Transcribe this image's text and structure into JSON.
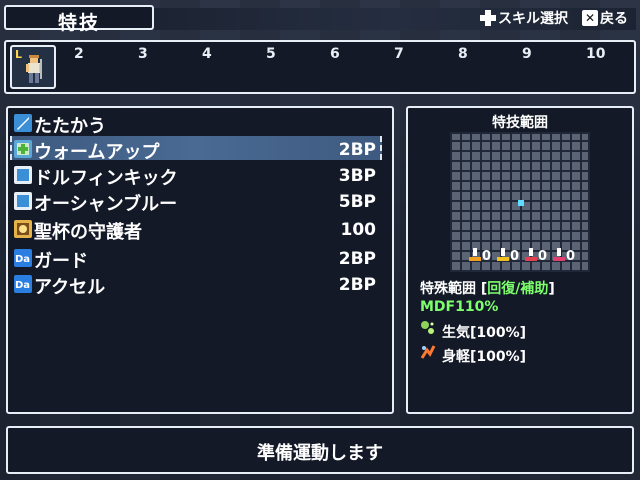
{
  "title": "特技",
  "hints": {
    "skill_select": "スキル選択",
    "back": "戻る",
    "back_key": "✕"
  },
  "party": {
    "leader_level_mark": "L",
    "slots": [
      "2",
      "3",
      "4",
      "5",
      "6",
      "7",
      "8",
      "9",
      "10"
    ]
  },
  "skills": [
    {
      "name": "たたかう",
      "cost": "",
      "icon": "sword-icon",
      "color": "#3a8fd6"
    },
    {
      "name": "ウォームアップ",
      "cost": "2BP",
      "icon": "plus-icon",
      "color": "#7ed957"
    },
    {
      "name": "ドルフィンキック",
      "cost": "3BP",
      "icon": "skill-square-icon",
      "color": "#3a8fd6"
    },
    {
      "name": "オーシャンブルー",
      "cost": "5BP",
      "icon": "skill-square-icon",
      "color": "#3a8fd6"
    },
    {
      "name": "聖杯の守護者",
      "cost": "100",
      "icon": "special-icon",
      "color": "#e6b34a"
    },
    {
      "name": "ガード",
      "cost": "2BP",
      "icon": "da-icon",
      "color": "#2a7de1"
    },
    {
      "name": "アクセル",
      "cost": "2BP",
      "icon": "da-icon",
      "color": "#2a7de1"
    }
  ],
  "selected_index": 1,
  "range": {
    "title": "特技範囲",
    "stat_values": [
      "0",
      "0",
      "0",
      "0"
    ],
    "special_range_label": "特殊範囲 [",
    "special_range_value": "回復/補助",
    "special_range_close": "]",
    "mdf": "MDF110%",
    "effects": [
      {
        "label": "生気[100%]",
        "icon": "regen-icon"
      },
      {
        "label": "身軽[100%]",
        "icon": "agility-icon"
      }
    ]
  },
  "message": "準備運動します"
}
